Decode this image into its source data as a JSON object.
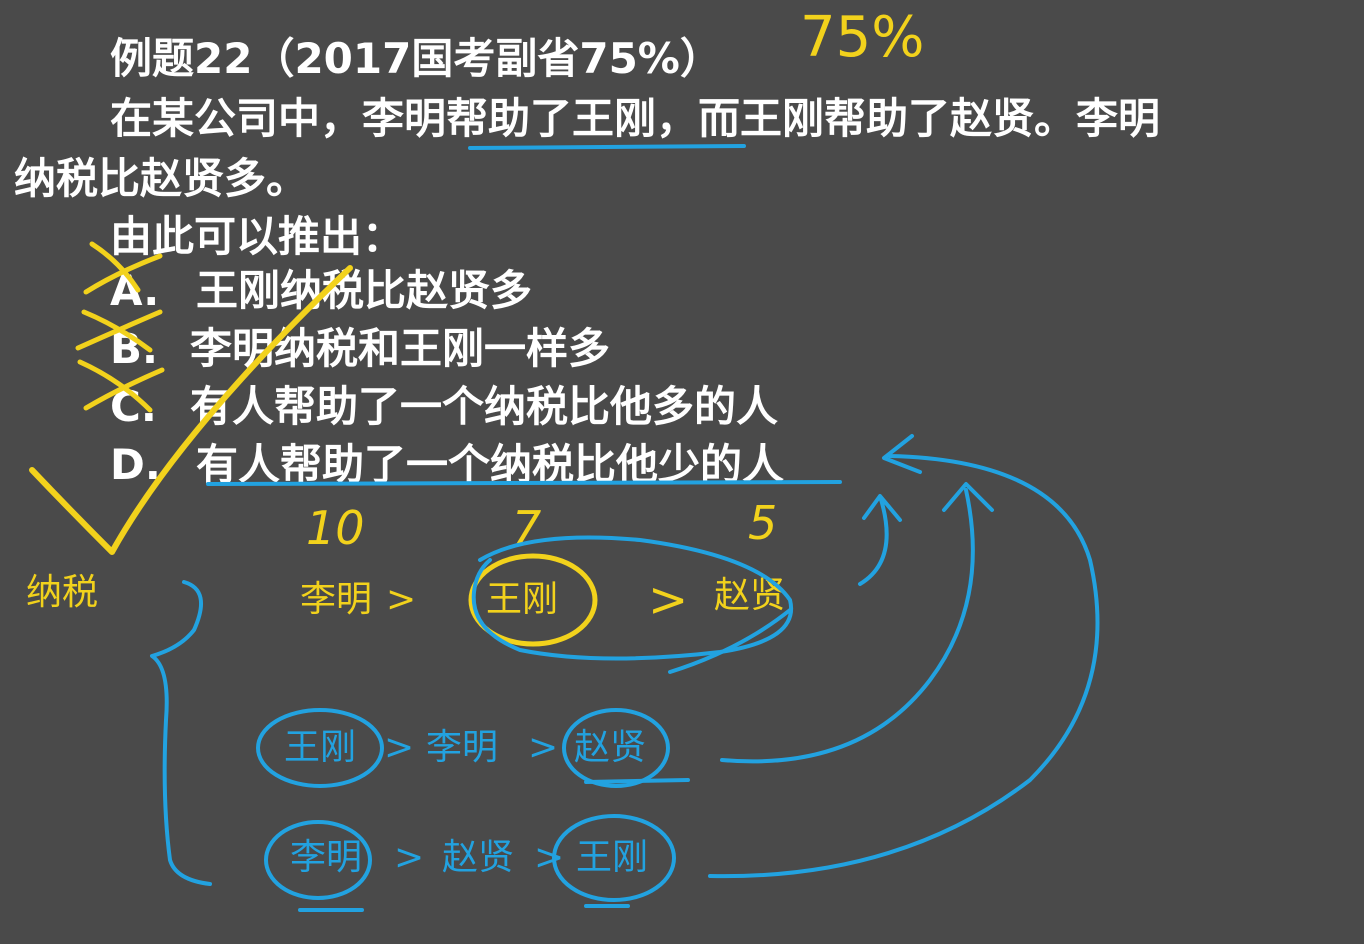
{
  "question": {
    "heading": "例题22（2017国考副省75%）",
    "stem_line1": "在某公司中，李明帮助了王刚，而王刚帮助了赵贤。李明",
    "stem_line2": "纳税比赵贤多。",
    "prompt": "由此可以推出：",
    "options": [
      {
        "letter": "A.",
        "text": "王刚纳税比赵贤多"
      },
      {
        "letter": "B.",
        "text": "李明纳税和王刚一样多"
      },
      {
        "letter": "C.",
        "text": "有人帮助了一个纳税比他多的人"
      },
      {
        "letter": "D.",
        "text": "有人帮助了一个纳税比他少的人"
      }
    ]
  },
  "annotations": {
    "top_note": "75%",
    "tax_label": "纳税",
    "numbers": [
      "10",
      "7",
      "5"
    ],
    "chain1": {
      "a": "李明",
      "gt1": ">",
      "b": "王刚",
      "gt2": ">",
      "c": "赵贤"
    },
    "chain2": {
      "a": "王刚",
      "gt1": ">",
      "b": "李明",
      "gt2": ">",
      "c": "赵贤"
    },
    "chain3": {
      "a": "李明",
      "gt1": ">",
      "b": "赵贤",
      "gt2": ">",
      "c": "王刚"
    }
  },
  "colors": {
    "background": "#4a4a4a",
    "text": "#ffffff",
    "yellow_ink": "#f2d21c",
    "blue_ink": "#22a2e0"
  }
}
